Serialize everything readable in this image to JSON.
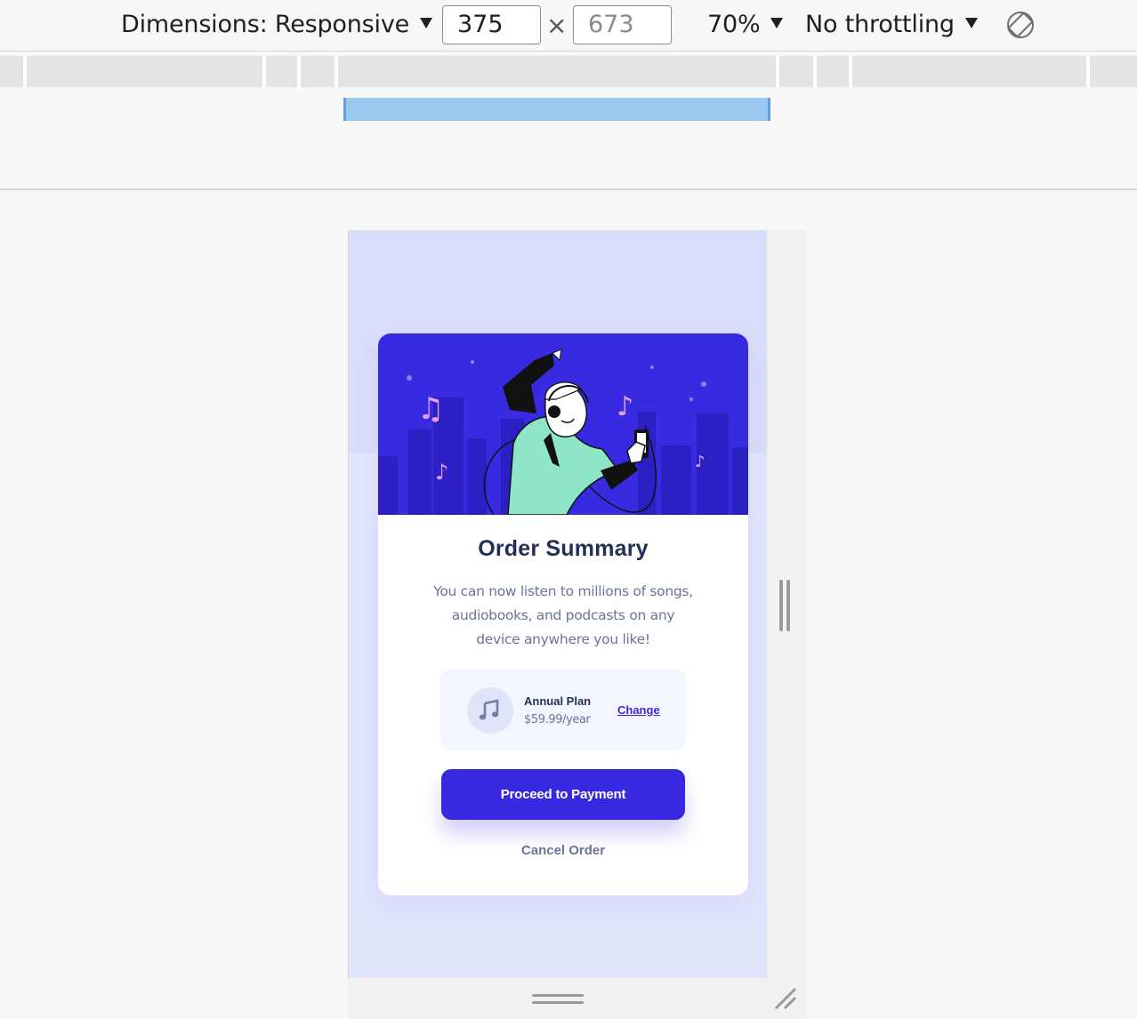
{
  "devtools": {
    "dimensions_label": "Dimensions: Responsive",
    "width_value": "375",
    "height_placeholder": "673",
    "times_sign": "×",
    "zoom": "70%",
    "throttling": "No throttling"
  },
  "card": {
    "title": "Order Summary",
    "description": "You can now listen to millions of songs, audiobooks, and podcasts on any device anywhere you like!",
    "plan": {
      "name": "Annual Plan",
      "price": "$59.99/year",
      "change_label": "Change",
      "icon": "music-note-icon"
    },
    "primary_button": "Proceed to Payment",
    "secondary_button": "Cancel Order"
  },
  "colors": {
    "primary": "#3829e0",
    "hero_bg": "#382ae1",
    "page_bg": "#e0e5fc",
    "title": "#1f2f56",
    "text": "#6b7498",
    "plan_bg": "#f4f6ff"
  }
}
